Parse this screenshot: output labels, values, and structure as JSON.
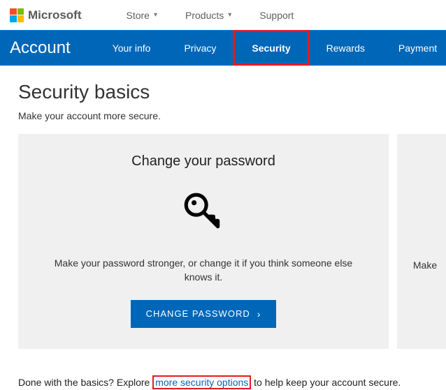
{
  "header": {
    "brand": "Microsoft",
    "nav": [
      {
        "label": "Store",
        "hasChevron": true
      },
      {
        "label": "Products",
        "hasChevron": true
      },
      {
        "label": "Support",
        "hasChevron": false
      }
    ]
  },
  "blueBar": {
    "title": "Account",
    "items": [
      {
        "label": "Your info",
        "active": false,
        "highlighted": false
      },
      {
        "label": "Privacy",
        "active": false,
        "highlighted": false
      },
      {
        "label": "Security",
        "active": true,
        "highlighted": true
      },
      {
        "label": "Rewards",
        "active": false,
        "highlighted": false
      },
      {
        "label": "Payment",
        "active": false,
        "highlighted": false
      }
    ]
  },
  "page": {
    "title": "Security basics",
    "subtitle": "Make your account more secure."
  },
  "card1": {
    "title": "Change your password",
    "desc": "Make your password stronger, or change it if you think someone else knows it.",
    "button": "CHANGE PASSWORD"
  },
  "card2Fragment": "Make",
  "footer": {
    "prefix": "Done with the basics? Explore ",
    "link": "more security options",
    "suffix": " to help keep your account secure."
  }
}
